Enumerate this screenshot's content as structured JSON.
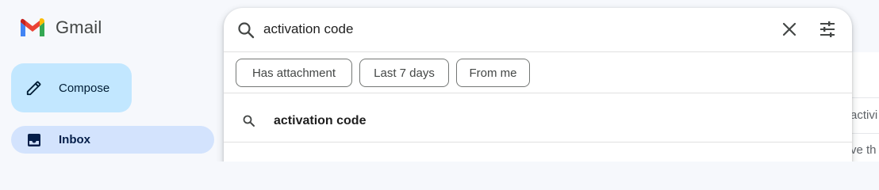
{
  "app": {
    "name": "Gmail"
  },
  "compose": {
    "label": "Compose"
  },
  "sidebar": {
    "items": [
      {
        "label": "Inbox",
        "icon": "inbox-icon"
      }
    ]
  },
  "search": {
    "value": "activation code",
    "clear_icon": "close-icon",
    "filter_icon": "tune-icon"
  },
  "chips": [
    {
      "label": "Has attachment"
    },
    {
      "label": "Last 7 days"
    },
    {
      "label": "From me"
    }
  ],
  "suggestions": [
    {
      "label": "activation code",
      "icon": "search-icon"
    }
  ],
  "background": {
    "peek_1": "activi",
    "peek_2": "ve th"
  },
  "colors": {
    "compose_bg": "#c2e7ff",
    "inbox_bg": "#d3e3fd",
    "page_bg": "#f6f8fc"
  }
}
